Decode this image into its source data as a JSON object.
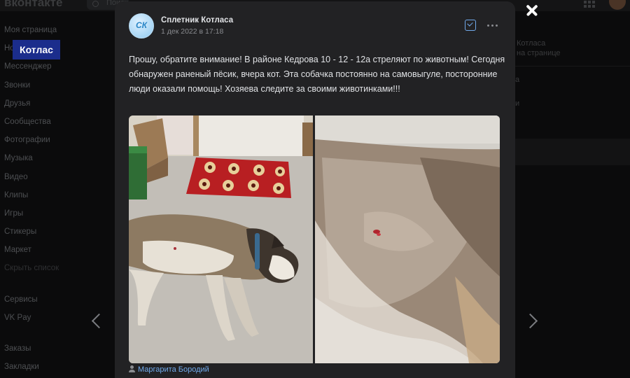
{
  "app": {
    "logo": "вконтакте",
    "search_placeholder": "Поиск"
  },
  "overlay_label": "Котлас",
  "sidebar": {
    "items": [
      {
        "label": "Моя страница"
      },
      {
        "label": "Новости"
      },
      {
        "label": "Мессенджер"
      },
      {
        "label": "Звонки"
      },
      {
        "label": "Друзья"
      },
      {
        "label": "Сообщества"
      },
      {
        "label": "Фотографии"
      },
      {
        "label": "Музыка"
      },
      {
        "label": "Видео"
      },
      {
        "label": "Клипы"
      },
      {
        "label": "Игры"
      },
      {
        "label": "Стикеры"
      },
      {
        "label": "Маркет"
      },
      {
        "label": "Скрыть список"
      },
      {
        "label": "Сервисы"
      },
      {
        "label": "VK Pay"
      },
      {
        "label": "Заказы"
      },
      {
        "label": "Закладки"
      }
    ]
  },
  "right_panel": {
    "title": "Котласа",
    "subtitle": "на странице",
    "line_a": "а",
    "line_b": "и"
  },
  "post": {
    "author": "Сплетник Котласа",
    "avatar_text": "СК",
    "date": "1 дек 2022 в 17:18",
    "text": "Прошу, обратите внимание! В районе Кедрова 10 - 12 - 12а стреляют по животным! Сегодня обнаружен раненый пёсик, вчера кот. Эта собачка постоянно на самовыгуле, посторонние люди оказали помощь! Хозяева следите за своими животинками!!!",
    "photo_credit": "Маргарита Бородий"
  },
  "colors": {
    "card_bg": "#222224",
    "page_bg": "#0b0b0c",
    "accent": "#71aaeb",
    "badge_bg": "#1b2d8c"
  },
  "icons": {
    "close": "close-icon",
    "prev": "chevron-left-icon",
    "next": "chevron-right-icon",
    "bookmark": "checkbox-icon",
    "more": "more-horizontal-icon",
    "user": "user-icon"
  }
}
